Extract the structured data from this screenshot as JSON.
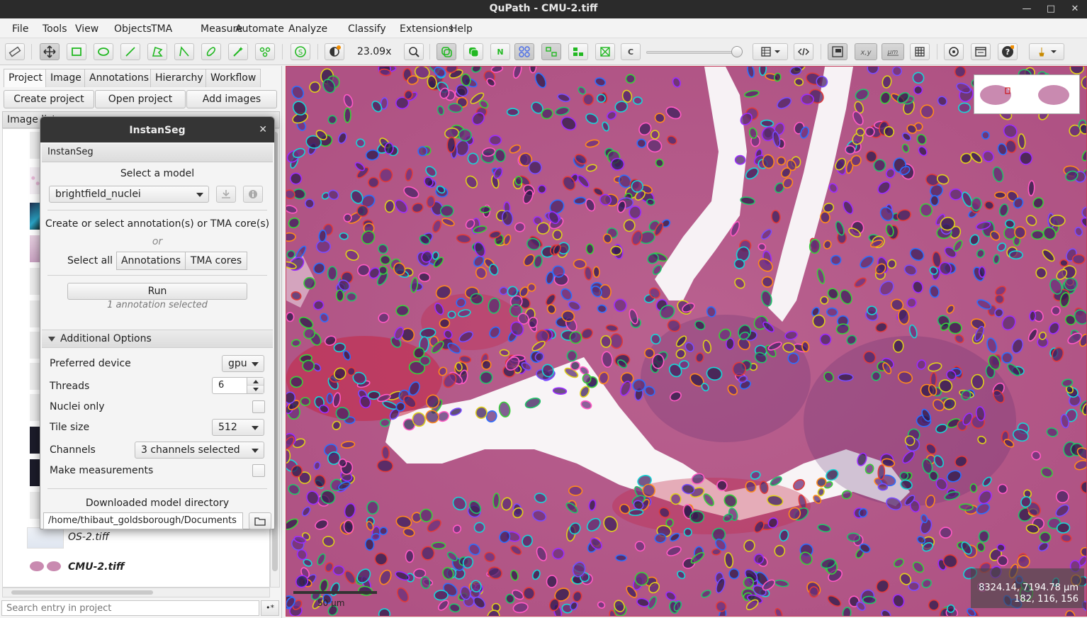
{
  "window": {
    "title": "QuPath - CMU-2.tiff",
    "controls": [
      "—",
      "□",
      "✕"
    ]
  },
  "menu": [
    "File",
    "Tools",
    "View",
    "Objects",
    "TMA",
    "Measure",
    "Automate",
    "Analyze",
    "Classify",
    "Extensions",
    "Help"
  ],
  "toolbar": {
    "zoom": "23.09x",
    "letter_buttons": {
      "n": "N",
      "c": "C"
    },
    "icons": [
      "ruler-icon",
      "move-icon",
      "rectangle-icon",
      "ellipse-icon",
      "line-icon",
      "polygon-icon",
      "polyline-icon",
      "brush-icon",
      "wand-icon",
      "points-icon",
      "selection-mode-icon",
      "brightness-contrast-icon",
      "zoom-to-fit-icon",
      "show-annotations-icon",
      "fill-annotations-icon",
      "show-names-icon",
      "show-tma-grid-icon",
      "show-detections-icon",
      "fill-detections-icon",
      "show-connections-icon",
      "pixel-classification-icon",
      "grid-icon",
      "script-icon",
      "overview-icon",
      "location-icon",
      "scalebar-icon",
      "counting-grid-icon",
      "preferences-icon",
      "log-icon",
      "help-icon",
      "extensions-icon"
    ]
  },
  "left_panel": {
    "tabs": [
      "Project",
      "Image",
      "Annotations",
      "Hierarchy",
      "Workflow"
    ],
    "buttons": [
      "Create project",
      "Open project",
      "Add images"
    ],
    "list_header": "Image list",
    "entries": [
      {
        "name": "OS-2.tiff",
        "bold": false
      },
      {
        "name": "CMU-2.tiff",
        "bold": true
      }
    ],
    "search_placeholder": "Search entry in project",
    "search_option": "•*"
  },
  "dialog": {
    "title": "InstanSeg",
    "close": "✕",
    "section": "InstanSeg",
    "select_model_label": "Select a model",
    "model_value": "brightfield_nuclei",
    "create_select_text": "Create or select annotation(s) or TMA core(s)",
    "or_text": "or",
    "select_all_label": "Select all",
    "select_buttons": [
      "Annotations",
      "TMA cores"
    ],
    "run_label": "Run",
    "status_text": "1 annotation selected",
    "additional_options": "Additional Options",
    "options": {
      "preferred_device": {
        "label": "Preferred device",
        "value": "gpu"
      },
      "threads": {
        "label": "Threads",
        "value": "6"
      },
      "nuclei_only": {
        "label": "Nuclei only",
        "checked": false
      },
      "tile_size": {
        "label": "Tile size",
        "value": "512"
      },
      "channels": {
        "label": "Channels",
        "value": "3 channels selected"
      },
      "make_measurements": {
        "label": "Make measurements",
        "checked": false
      }
    },
    "model_dir_label": "Downloaded model directory",
    "model_dir_value": "/home/thibaut_goldsborough/Documents"
  },
  "viewer": {
    "coordinates": "8324.14, 7194.78 µm",
    "rgb": "182, 116, 156",
    "scale_label": "50 µm"
  },
  "colors": {
    "titlebar": "#2b2b2b",
    "dialog_title": "#353535",
    "tissue_base": "#c46a93",
    "tool_green": "#22b822"
  }
}
